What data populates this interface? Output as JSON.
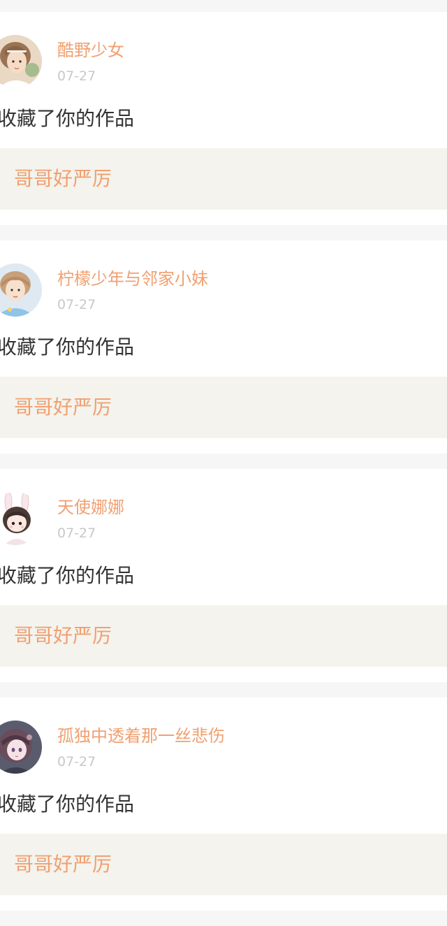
{
  "feed": {
    "items": [
      {
        "user_name": "酷野少女",
        "date": "07-27",
        "action": "收藏了你的作品",
        "quote": "哥哥好严厉",
        "avatar_icon": "avatar-girl-photo"
      },
      {
        "user_name": "柠檬少年与邻家小妹",
        "date": "07-27",
        "action": "收藏了你的作品",
        "quote": "哥哥好严厉",
        "avatar_icon": "avatar-boy-photo"
      },
      {
        "user_name": "天使娜娜",
        "date": "07-27",
        "action": "收藏了你的作品",
        "quote": "哥哥好严厉",
        "avatar_icon": "avatar-bunny-cartoon"
      },
      {
        "user_name": "孤独中透着那一丝悲伤",
        "date": "07-27",
        "action": "收藏了你的作品",
        "quote": "哥哥好严厉",
        "avatar_icon": "avatar-anime-girl"
      }
    ]
  },
  "colors": {
    "accent": "#f0a071",
    "date": "#c8c8c8",
    "text": "#333333",
    "quote_bg": "#f4f3ed",
    "page_bg": "#f6f6f6"
  }
}
